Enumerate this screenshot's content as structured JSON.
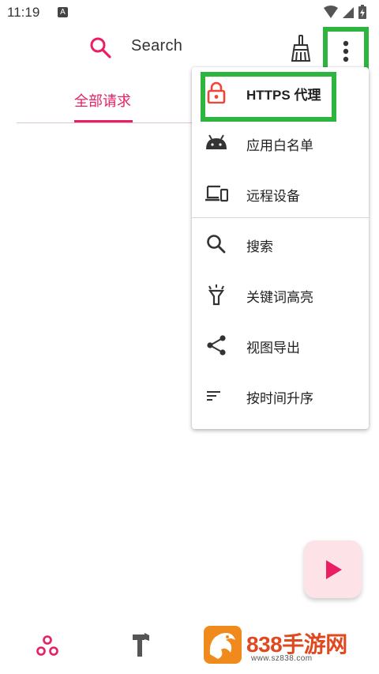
{
  "status_bar": {
    "time": "11:19",
    "indicator": "A"
  },
  "toolbar": {
    "search_label": "Search",
    "search_icon": "search-icon",
    "clean_icon": "broom-icon",
    "more_icon": "more-vert-icon"
  },
  "tabs": [
    {
      "label": "全部请求",
      "selected": true
    }
  ],
  "menu": {
    "items": [
      {
        "label": "HTTPS 代理",
        "icon": "lock-icon"
      },
      {
        "label": "应用白名单",
        "icon": "android-icon"
      },
      {
        "label": "远程设备",
        "icon": "devices-icon"
      },
      {
        "label": "搜索",
        "icon": "search-icon"
      },
      {
        "label": "关键词高亮",
        "icon": "highlight-icon"
      },
      {
        "label": "视图导出",
        "icon": "share-icon"
      },
      {
        "label": "按时间升序",
        "icon": "sort-icon"
      }
    ]
  },
  "fab": {
    "icon": "play-icon"
  },
  "bottom_nav": {
    "items": [
      {
        "icon": "requests-icon"
      },
      {
        "icon": "tools-icon"
      }
    ]
  },
  "watermark": {
    "title": "838手游网",
    "url": "www.sz838.com"
  },
  "colors": {
    "accent": "#e91e63",
    "highlight_box": "#2db53f",
    "fab_background": "#fde2e8",
    "lock_icon": "#f44336"
  }
}
